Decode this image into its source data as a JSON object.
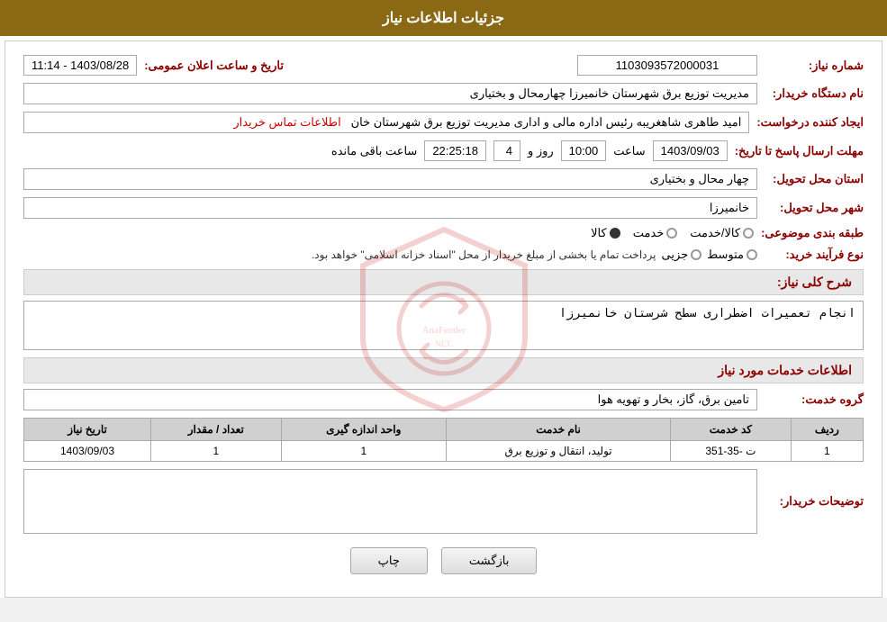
{
  "header": {
    "title": "جزئیات اطلاعات نیاز"
  },
  "fields": {
    "need_number_label": "شماره نیاز:",
    "need_number_value": "1103093572000031",
    "public_announce_label": "تاریخ و ساعت اعلان عمومی:",
    "public_announce_value": "1403/08/28 - 11:14",
    "buyer_org_label": "نام دستگاه خریدار:",
    "buyer_org_value": "مدیریت توزیع برق شهرستان خانمیرزا چهارمحال و بختیاری",
    "requester_label": "ایجاد کننده درخواست:",
    "requester_value": "امید طاهری شاهغریبه رئیس اداره مالی و اداری مدیریت توزیع برق شهرستان خان",
    "contact_info_label": "اطلاعات تماس خریدار",
    "deadline_label": "مهلت ارسال پاسخ تا تاریخ:",
    "deadline_date": "1403/09/03",
    "deadline_time_label": "ساعت",
    "deadline_time": "10:00",
    "deadline_days_label": "روز و",
    "deadline_days": "4",
    "deadline_remaining_label": "ساعت باقی مانده",
    "deadline_remaining": "22:25:18",
    "province_label": "استان محل تحویل:",
    "province_value": "چهار محال و بختیاری",
    "city_label": "شهر محل تحویل:",
    "city_value": "خانمیرزا",
    "category_label": "طبقه بندی موضوعی:",
    "category_options": [
      "کالا",
      "خدمت",
      "کالا/خدمت"
    ],
    "category_selected": "کالا",
    "purchase_type_label": "نوع فرآیند خرید:",
    "purchase_options": [
      "جزیی",
      "متوسط"
    ],
    "purchase_note": "پرداخت تمام یا بخشی از مبلغ خریدار از محل \"اسناد خزانه اسلامی\" خواهد بود.",
    "need_desc_label": "شرح کلی نیاز:",
    "need_desc_value": "انجام تعمیرات اضطراری سطح شرستان خانمیرزا",
    "services_section_label": "اطلاعات خدمات مورد نیاز",
    "service_group_label": "گروه خدمت:",
    "service_group_value": "تامین برق، گاز، بخار و تهویه هوا",
    "table": {
      "headers": [
        "ردیف",
        "کد خدمت",
        "نام خدمت",
        "واحد اندازه گیری",
        "تعداد / مقدار",
        "تاریخ نیاز"
      ],
      "rows": [
        {
          "row": "1",
          "code": "ت -35-351",
          "name": "تولید، انتقال و توزیع برق",
          "unit": "1",
          "quantity": "1",
          "date": "1403/09/03"
        }
      ]
    },
    "buyer_comments_label": "توضیحات خریدار:",
    "buyer_comments_value": ""
  },
  "buttons": {
    "back_label": "بازگشت",
    "print_label": "چاپ"
  }
}
